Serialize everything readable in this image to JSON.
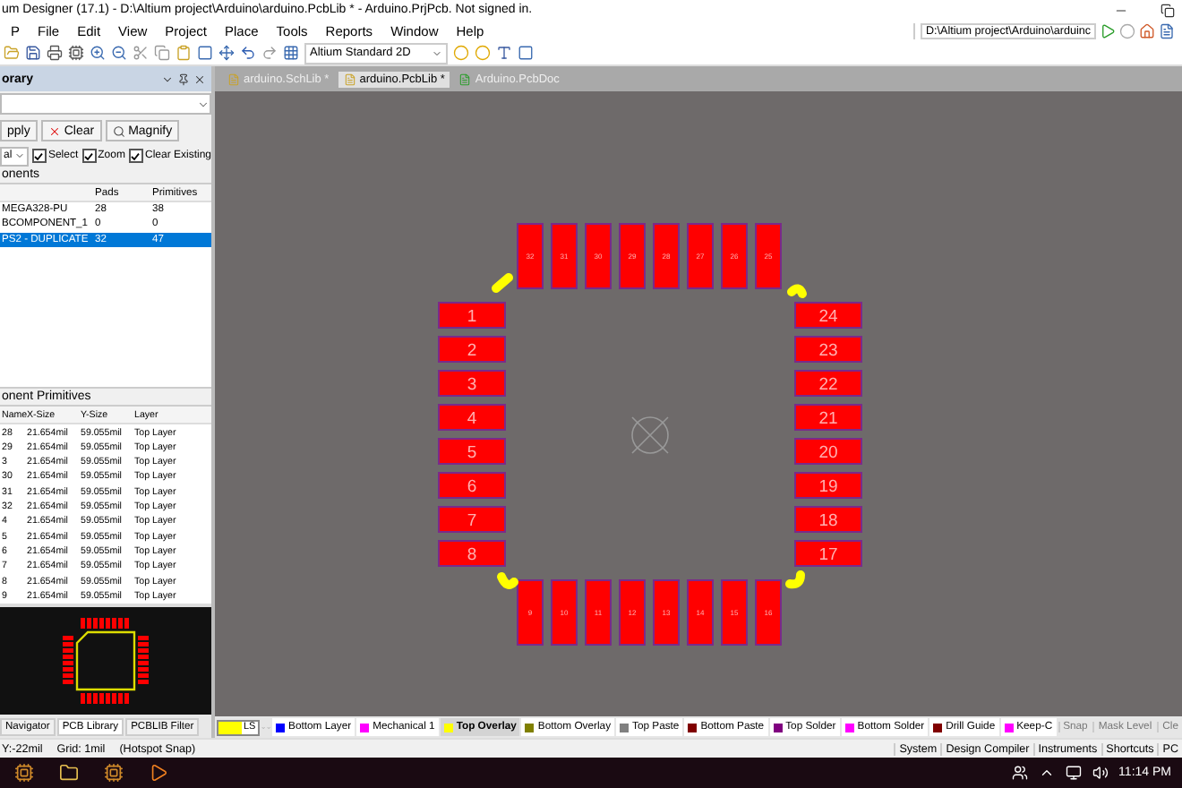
{
  "window": {
    "title": "um Designer (17.1) - D:\\Altium project\\Arduino\\arduino.PcbLib * - Arduino.PrjPcb. Not signed in."
  },
  "menu": [
    "P",
    "File",
    "Edit",
    "View",
    "Project",
    "Place",
    "Tools",
    "Reports",
    "Window",
    "Help"
  ],
  "path_field": {
    "value": "D:\\Altium project\\Arduino\\arduinc"
  },
  "view_select": {
    "value": "Altium Standard 2D"
  },
  "doc_tabs": [
    {
      "label": "arduino.SchLib *",
      "selected": false
    },
    {
      "label": "arduino.PcbLib *",
      "selected": true
    },
    {
      "label": "Arduino.PcbDoc",
      "selected": false
    }
  ],
  "library_panel": {
    "title": "orary",
    "buttons": [
      "pply",
      "Clear",
      "Magnify"
    ],
    "mode_select": "al",
    "options": [
      {
        "label": "Select",
        "checked": true
      },
      {
        "label": "Zoom",
        "checked": true
      },
      {
        "label": "Clear Existing",
        "checked": true
      }
    ],
    "components": {
      "title": "onents",
      "columns": [
        "Pads",
        "Primitives"
      ],
      "rows": [
        {
          "name": "MEGA328-PU",
          "pads": "28",
          "primitives": "38",
          "selected": false
        },
        {
          "name": "BCOMPONENT_1",
          "pads": "0",
          "primitives": "0",
          "selected": false
        },
        {
          "name": "PS2 - DUPLICATE",
          "pads": "32",
          "primitives": "47",
          "selected": true
        }
      ]
    },
    "primitives": {
      "title": "onent Primitives",
      "columns": [
        "Name",
        "X-Size",
        "Y-Size",
        "Layer"
      ],
      "rows": [
        [
          "28",
          "21.654mil",
          "59.055mil",
          "Top Layer"
        ],
        [
          "29",
          "21.654mil",
          "59.055mil",
          "Top Layer"
        ],
        [
          "3",
          "21.654mil",
          "59.055mil",
          "Top Layer"
        ],
        [
          "30",
          "21.654mil",
          "59.055mil",
          "Top Layer"
        ],
        [
          "31",
          "21.654mil",
          "59.055mil",
          "Top Layer"
        ],
        [
          "32",
          "21.654mil",
          "59.055mil",
          "Top Layer"
        ],
        [
          "4",
          "21.654mil",
          "59.055mil",
          "Top Layer"
        ],
        [
          "5",
          "21.654mil",
          "59.055mil",
          "Top Layer"
        ],
        [
          "6",
          "21.654mil",
          "59.055mil",
          "Top Layer"
        ],
        [
          "7",
          "21.654mil",
          "59.055mil",
          "Top Layer"
        ],
        [
          "8",
          "21.654mil",
          "59.055mil",
          "Top Layer"
        ],
        [
          "9",
          "21.654mil",
          "59.055mil",
          "Top Layer"
        ]
      ]
    },
    "panel_tabs": [
      {
        "label": "Navigator",
        "selected": false
      },
      {
        "label": "PCB Library",
        "selected": true
      },
      {
        "label": "PCBLIB Filter",
        "selected": false
      }
    ]
  },
  "footprint": {
    "left_pads": [
      "1",
      "2",
      "3",
      "4",
      "5",
      "6",
      "7",
      "8"
    ],
    "right_pads": [
      "24",
      "23",
      "22",
      "21",
      "20",
      "19",
      "18",
      "17"
    ],
    "top_pads": [
      "32",
      "31",
      "30",
      "29",
      "28",
      "27",
      "26",
      "25"
    ],
    "bottom_pads": [
      "9",
      "10",
      "11",
      "12",
      "13",
      "14",
      "15",
      "16"
    ]
  },
  "layer_bar": {
    "current": "LS",
    "layers": [
      {
        "name": "Bottom Layer",
        "color": "#0000ff",
        "selected": false
      },
      {
        "name": "Mechanical 1",
        "color": "#ff00ff",
        "selected": false
      },
      {
        "name": "Top Overlay",
        "color": "#ffff00",
        "selected": true
      },
      {
        "name": "Bottom Overlay",
        "color": "#808000",
        "selected": false
      },
      {
        "name": "Top Paste",
        "color": "#808080",
        "selected": false
      },
      {
        "name": "Bottom Paste",
        "color": "#800000",
        "selected": false
      },
      {
        "name": "Top Solder",
        "color": "#800080",
        "selected": false
      },
      {
        "name": "Bottom Solder",
        "color": "#ff00ff",
        "selected": false
      },
      {
        "name": "Drill Guide",
        "color": "#800000",
        "selected": false
      },
      {
        "name": "Keep-C",
        "color": "#ff00ff",
        "selected": false
      }
    ],
    "buttons": [
      "Snap",
      "Mask Level",
      "Cle"
    ]
  },
  "status_bar": {
    "coords": "Y:-22mil",
    "grid": "Grid: 1mil",
    "snap": "(Hotspot Snap)",
    "panels": [
      "System",
      "Design Compiler",
      "Instruments",
      "Shortcuts",
      "PC"
    ]
  },
  "taskbar": {
    "time": "11:14 PM"
  }
}
